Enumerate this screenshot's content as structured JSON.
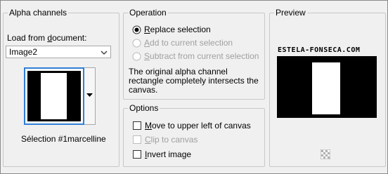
{
  "alpha_channels": {
    "title": "Alpha channels",
    "load_label_pre": "Load from ",
    "load_label_u": "d",
    "load_label_post": "ocument:",
    "document_value": "Image2",
    "selection_name": "Sélection #1marcelline"
  },
  "operation": {
    "title": "Operation",
    "options": [
      {
        "u": "R",
        "rest": "eplace selection",
        "selected": true,
        "enabled": true
      },
      {
        "u": "A",
        "rest": "dd to current selection",
        "selected": false,
        "enabled": false
      },
      {
        "u": "S",
        "rest": "ubtract from current selection",
        "selected": false,
        "enabled": false
      }
    ],
    "info_line1": "The original alpha channel",
    "info_line2": "rectangle completely intersects the",
    "info_line3": "canvas."
  },
  "options": {
    "title": "Options",
    "move_u": "M",
    "move_rest": "ove to upper left of canvas",
    "move_checked": false,
    "clip_u": "C",
    "clip_rest": "lip to canvas",
    "clip_enabled": false,
    "invert_u": "I",
    "invert_rest": "nvert image",
    "invert_checked": false
  },
  "preview": {
    "title": "Preview",
    "watermark": "ESTELA-FONSECA.COM"
  },
  "icons": {
    "dropdown": "chevron-down-icon",
    "thumb_arrow": "triangle-down-icon",
    "checker": "transparency-checker-icon"
  }
}
